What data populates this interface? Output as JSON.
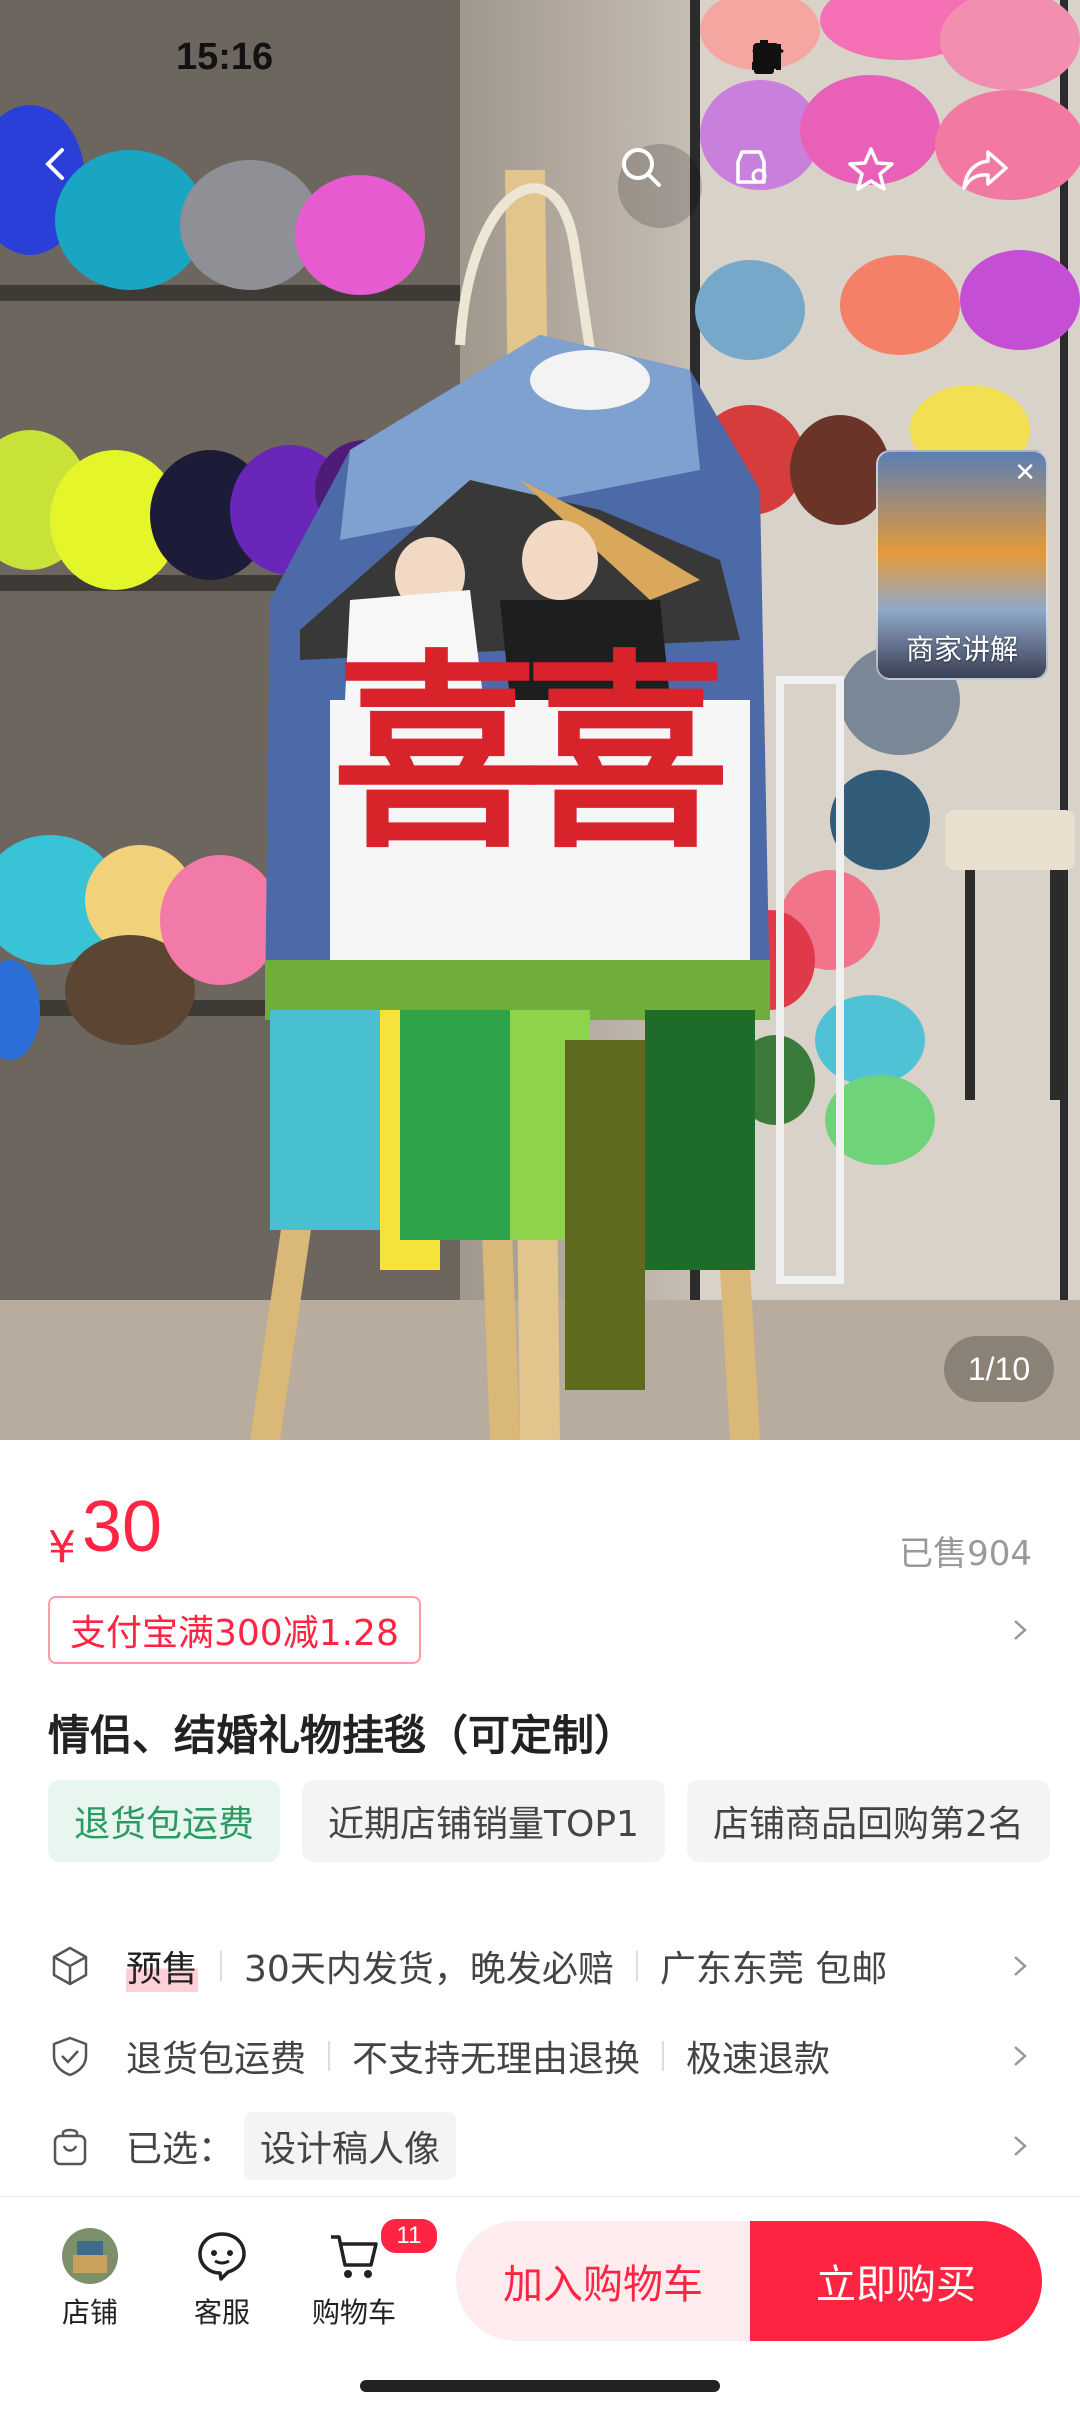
{
  "status": {
    "time": "15:16"
  },
  "hero": {
    "page_counter": "1/10",
    "mini_video_label": "商家讲解",
    "artwork_chars": [
      "喜",
      "喜"
    ]
  },
  "product": {
    "currency": "¥",
    "price": "30",
    "sold": "已售904",
    "coupon": "支付宝满300减1.28",
    "title": "情侣、结婚礼物挂毯（可定制）",
    "tags": [
      "退货包运费",
      "近期店铺销量TOP1",
      "店铺商品回购第2名"
    ]
  },
  "info": {
    "shipping": {
      "presale": "预售",
      "delivery": "30天内发货，晚发必赔",
      "location": "广东东莞 包邮"
    },
    "service": {
      "a": "退货包运费",
      "b": "不支持无理由退换",
      "c": "极速退款"
    },
    "selected": {
      "label": "已选：",
      "value": "设计稿人像"
    }
  },
  "bottom": {
    "shop": "店铺",
    "service": "客服",
    "cart": "购物车",
    "cart_badge": "11",
    "add_to_cart": "加入购物车",
    "buy_now": "立即购买"
  },
  "colors": {
    "accent": "#ff2442",
    "green": "#2b9a63"
  }
}
